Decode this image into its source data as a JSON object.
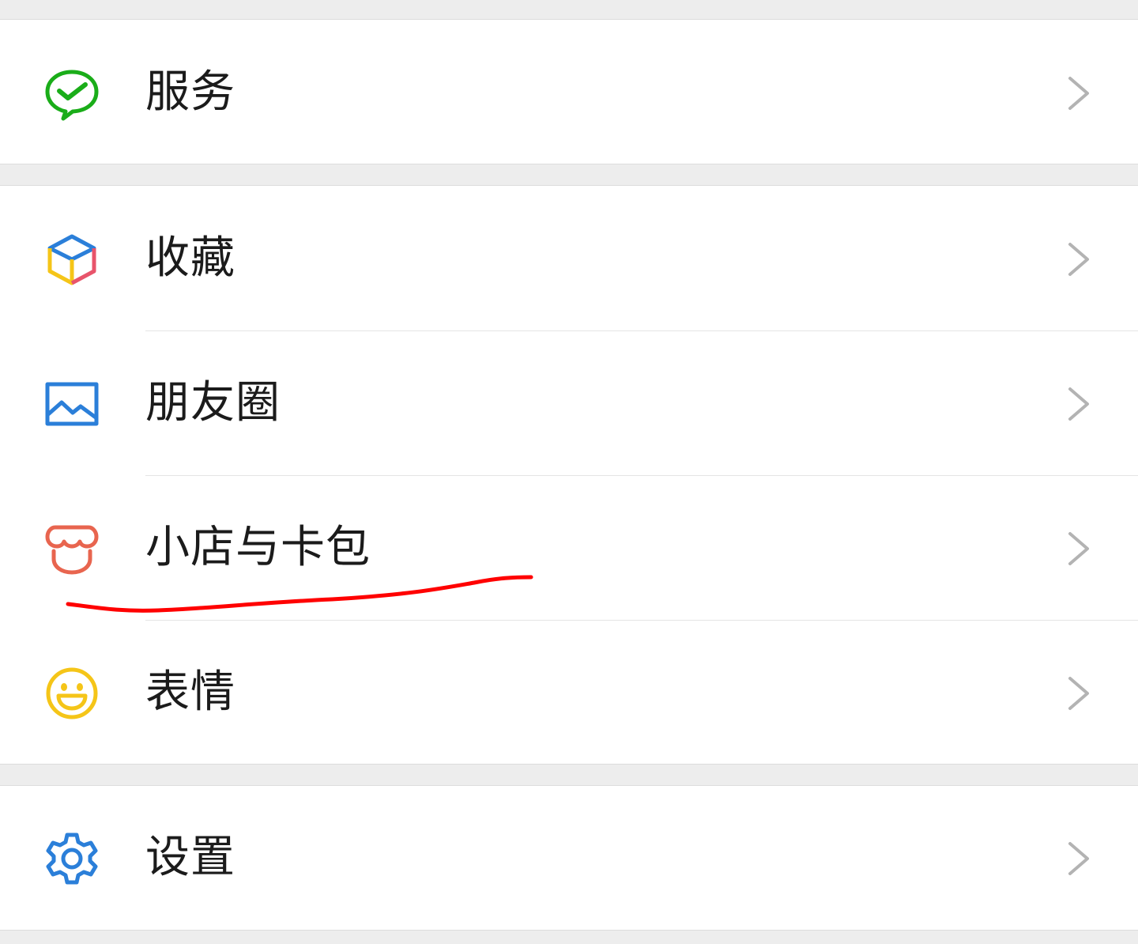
{
  "menu": {
    "items": [
      {
        "label": "服务",
        "icon": "wechat-pay-service-icon",
        "color": "#1aad19"
      },
      {
        "label": "收藏",
        "icon": "favorites-cube-icon",
        "color": "#2b7fd9"
      },
      {
        "label": "朋友圈",
        "icon": "moments-image-icon",
        "color": "#2b7fd9"
      },
      {
        "label": "小店与卡包",
        "icon": "shop-awning-icon",
        "color": "#e8654f"
      },
      {
        "label": "表情",
        "icon": "smiley-face-icon",
        "color": "#f5c518"
      },
      {
        "label": "设置",
        "icon": "gear-icon",
        "color": "#2b7fd9"
      }
    ]
  },
  "annotation": {
    "color": "#ff0000"
  }
}
